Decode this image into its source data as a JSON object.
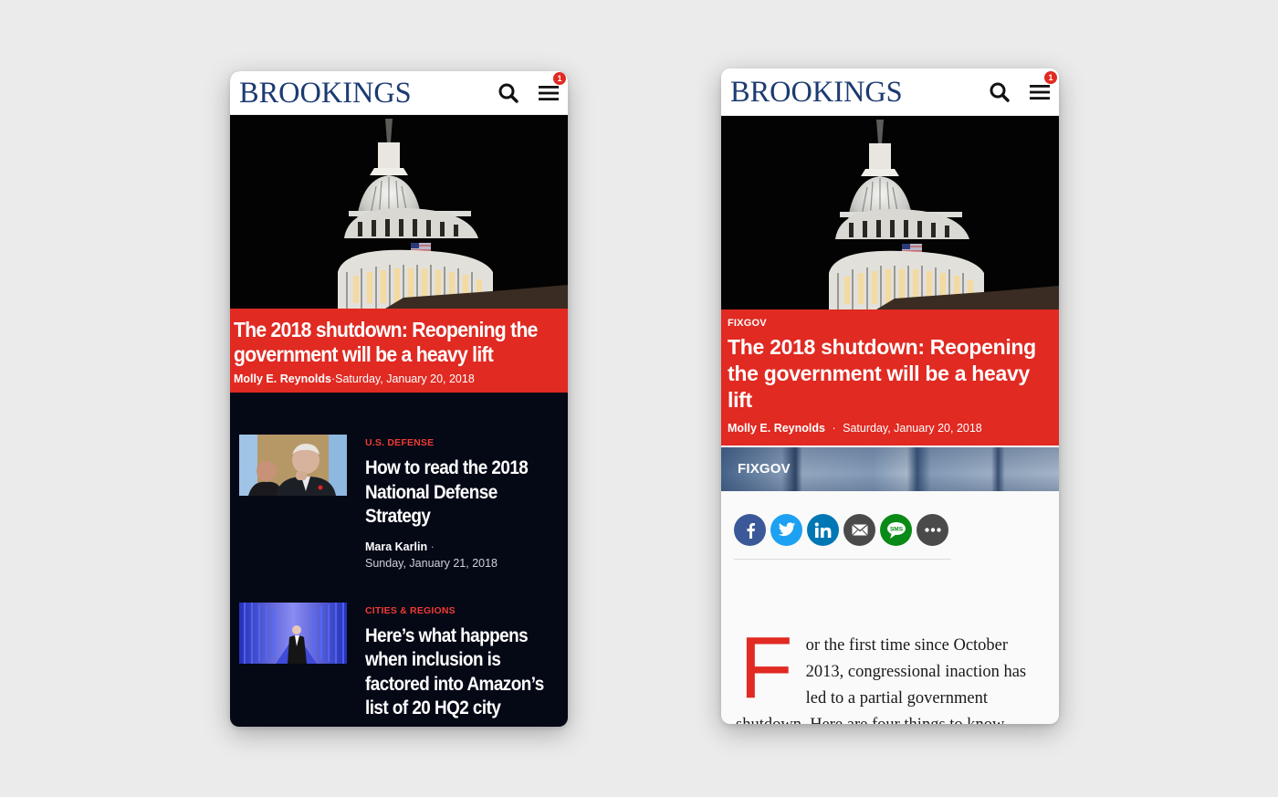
{
  "brand": {
    "logo": "BROOKINGS",
    "logo_color": "#1c3b72",
    "accent_red": "#e02a22",
    "notification_count": "1"
  },
  "icons": {
    "search": "search-icon",
    "menu": "hamburger-menu-icon"
  },
  "left_phone": {
    "hero": {
      "image_alt": "U.S. Capitol dome at night",
      "title": "The 2018 shutdown: Reopening the government will be a heavy lift",
      "author": "Molly E. Reynolds",
      "separator": "·",
      "date": "Saturday, January 20, 2018"
    },
    "articles": [
      {
        "category": "U.S. DEFENSE",
        "title": "How to read the 2018 National Defense Strategy",
        "author": "Mara Karlin",
        "separator": "·",
        "date": "Sunday, January 21, 2018",
        "image_alt": "Man in suit resting chin on hand"
      },
      {
        "category": "CITIES & REGIONS",
        "title": "Here’s what happens when inclusion is factored into Amazon’s list of 20 HQ2 city",
        "author": "",
        "separator": "",
        "date": "",
        "image_alt": "Man walking through blue-lit server aisle"
      }
    ]
  },
  "right_phone": {
    "hero": {
      "image_alt": "U.S. Capitol dome at night",
      "category": "FIXGOV",
      "title": "The 2018 shutdown: Reopening the government will be a heavy lift",
      "author": "Molly E. Reynolds",
      "separator": "·",
      "date": "Saturday, January 20, 2018"
    },
    "series_banner": "FIXGOV",
    "share_buttons": [
      {
        "name": "facebook",
        "glyph": "f",
        "color": "#3b5998"
      },
      {
        "name": "twitter",
        "glyph": "t",
        "color": "#1da1f2"
      },
      {
        "name": "linkedin",
        "glyph": "in",
        "color": "#0077b5"
      },
      {
        "name": "email",
        "glyph": "✉",
        "color": "#4a4a4a"
      },
      {
        "name": "sms",
        "glyph": "SMS",
        "color": "#0a8a16"
      },
      {
        "name": "more",
        "glyph": "•••",
        "color": "#4a4a4a"
      }
    ],
    "article": {
      "dropcap": "F",
      "body": "or the first time since October 2013, congressional inaction has led to a partial government shutdown. Here are four things to know"
    }
  }
}
